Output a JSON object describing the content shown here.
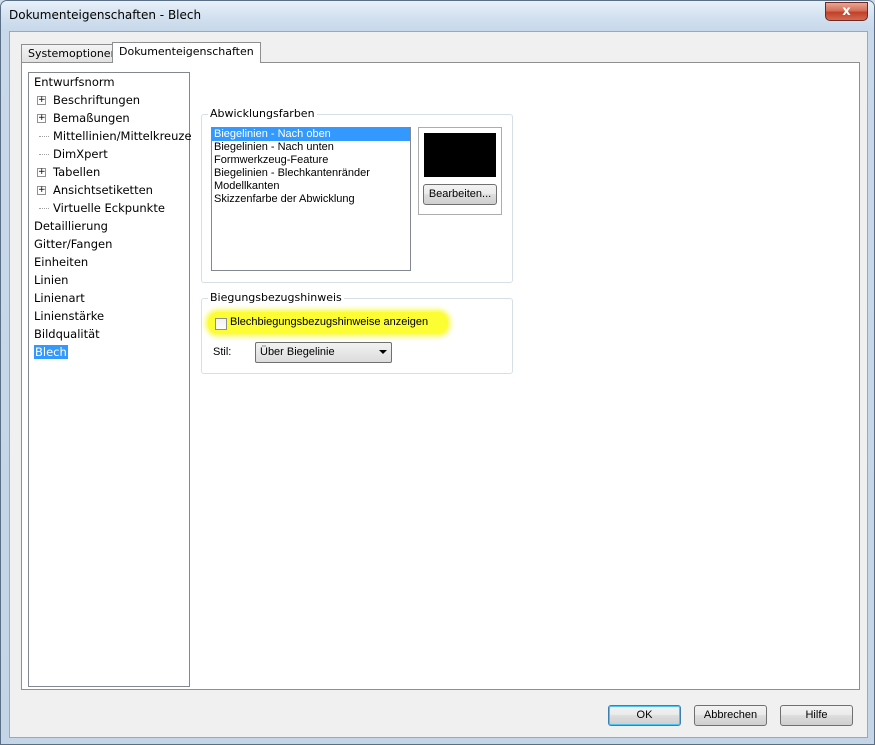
{
  "window": {
    "title": "Dokumenteigenschaften - Blech",
    "close_glyph": "x"
  },
  "tabs": [
    {
      "label": "Systemoptionen",
      "active": false
    },
    {
      "label": "Dokumenteigenschaften",
      "active": true
    }
  ],
  "tree": {
    "items": [
      {
        "label": "Entwurfsnorm",
        "level": 0,
        "expander": ""
      },
      {
        "label": "Beschriftungen",
        "level": 1,
        "expander": "+"
      },
      {
        "label": "Bemaßungen",
        "level": 1,
        "expander": "+"
      },
      {
        "label": "Mittellinien/Mittelkreuze",
        "level": 1,
        "expander": ""
      },
      {
        "label": "DimXpert",
        "level": 1,
        "expander": ""
      },
      {
        "label": "Tabellen",
        "level": 1,
        "expander": "+"
      },
      {
        "label": "Ansichtsetiketten",
        "level": 1,
        "expander": "+"
      },
      {
        "label": "Virtuelle Eckpunkte",
        "level": 1,
        "expander": ""
      },
      {
        "label": "Detaillierung",
        "level": 0,
        "expander": ""
      },
      {
        "label": "Gitter/Fangen",
        "level": 0,
        "expander": ""
      },
      {
        "label": "Einheiten",
        "level": 0,
        "expander": ""
      },
      {
        "label": "Linien",
        "level": 0,
        "expander": ""
      },
      {
        "label": "Linienart",
        "level": 0,
        "expander": ""
      },
      {
        "label": "Linienstärke",
        "level": 0,
        "expander": ""
      },
      {
        "label": "Bildqualität",
        "level": 0,
        "expander": ""
      },
      {
        "label": "Blech",
        "level": 0,
        "expander": "",
        "selected": true
      }
    ]
  },
  "abwicklungsfarben": {
    "legend": "Abwicklungsfarben",
    "items": [
      {
        "label": "Biegelinien - Nach oben",
        "selected": true
      },
      {
        "label": "Biegelinien - Nach unten"
      },
      {
        "label": "Formwerkzeug-Feature"
      },
      {
        "label": "Biegelinien - Blechkantenränder"
      },
      {
        "label": "Modellkanten"
      },
      {
        "label": "Skizzenfarbe der Abwicklung"
      }
    ],
    "swatch_color": "#000000",
    "edit_button": "Bearbeiten..."
  },
  "biegungsbezugshinweis": {
    "legend": "Biegungsbezugshinweis",
    "checkbox_label": "Blechbiegungsbezugshinweise anzeigen",
    "checked": false,
    "style_label": "Stil:",
    "style_value": "Über Biegelinie"
  },
  "buttons": {
    "ok": "OK",
    "cancel": "Abbrechen",
    "help": "Hilfe"
  },
  "colors": {
    "selection": "#3399ff",
    "highlight": "#fdfd33"
  }
}
